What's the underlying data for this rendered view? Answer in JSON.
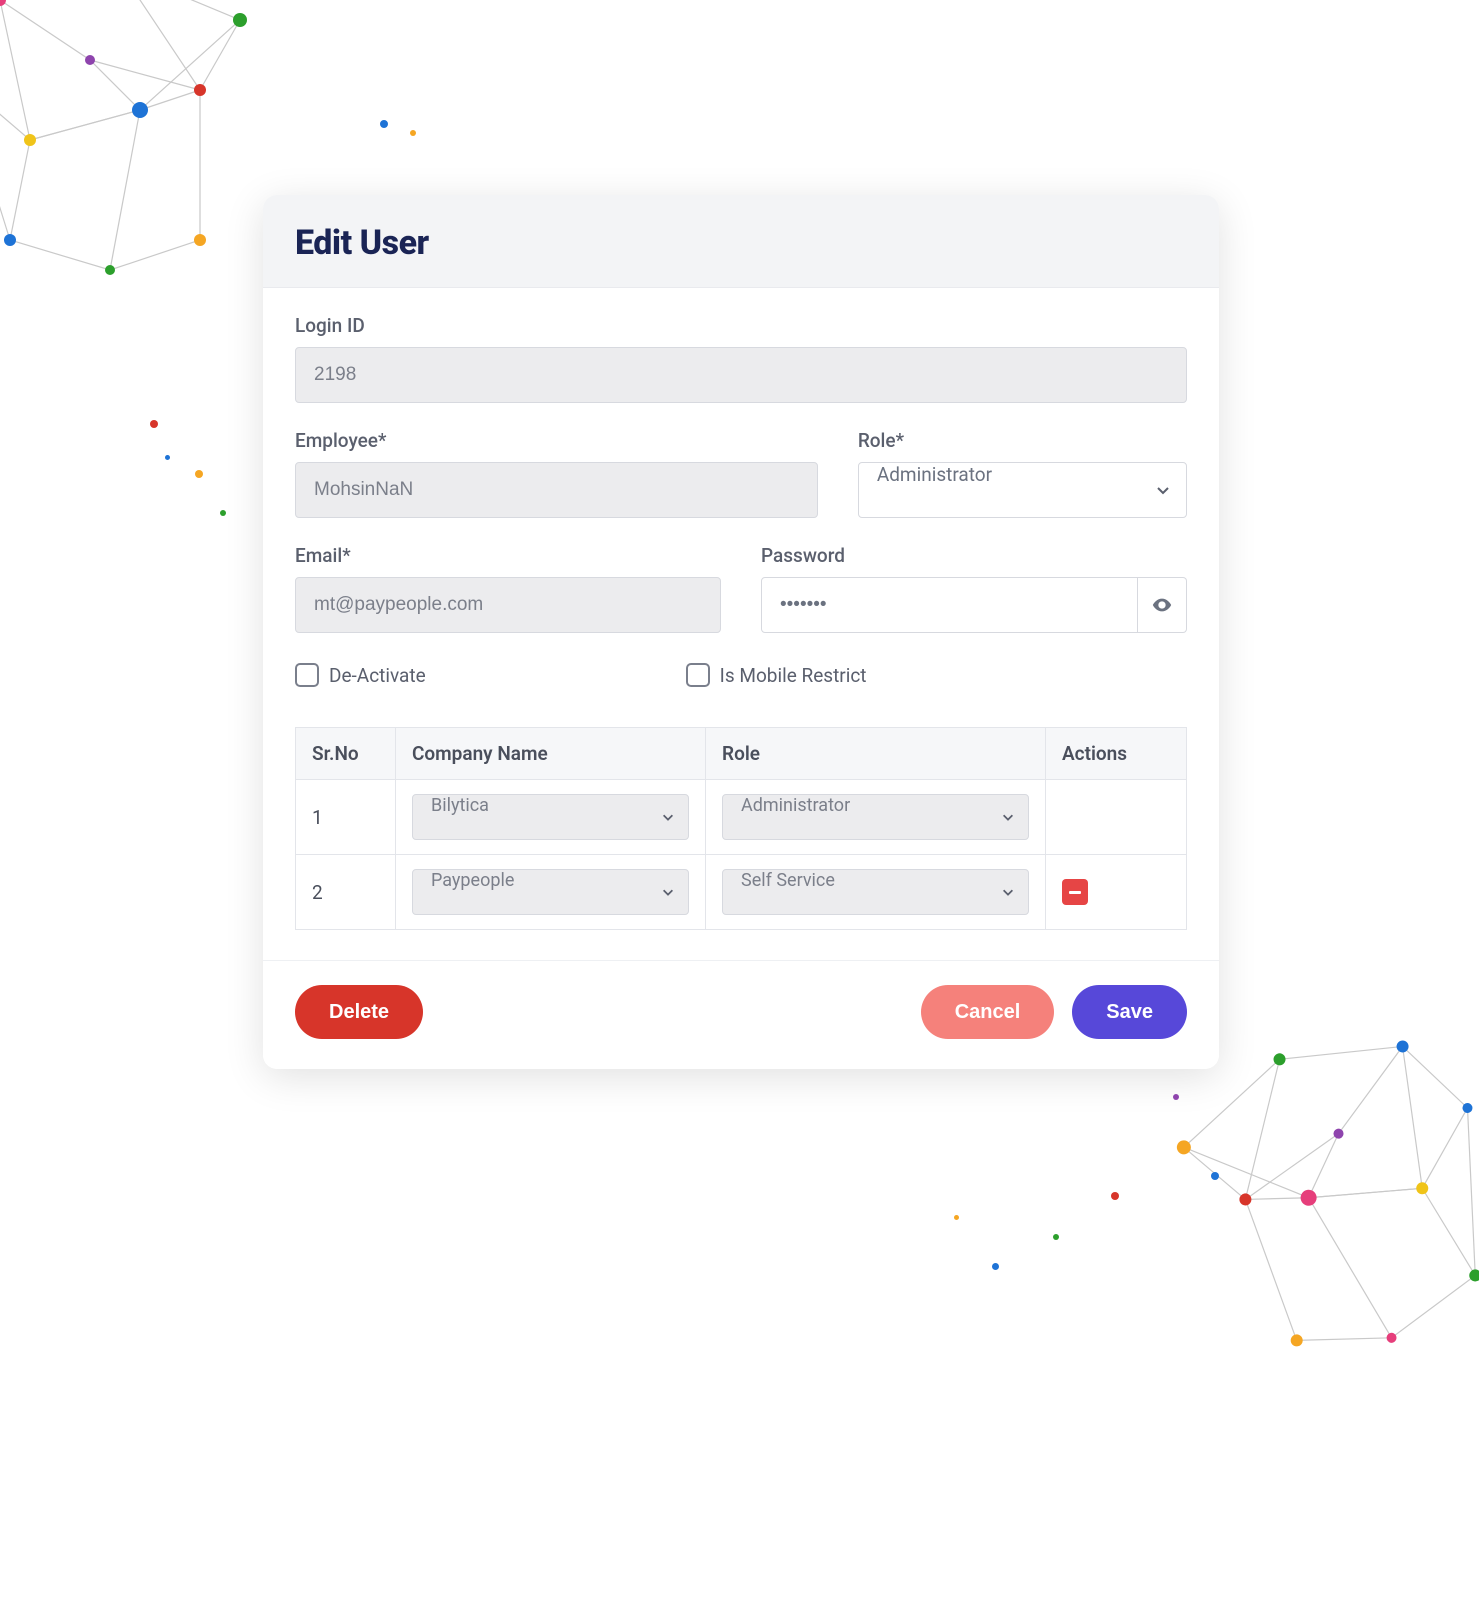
{
  "header": {
    "title": "Edit User"
  },
  "fields": {
    "login_id": {
      "label": "Login ID",
      "value": "2198"
    },
    "employee": {
      "label": "Employee*",
      "value": "MohsinNaN"
    },
    "role": {
      "label": "Role*",
      "value": "Administrator"
    },
    "email": {
      "label": "Email*",
      "value": "mt@paypeople.com"
    },
    "password": {
      "label": "Password",
      "value": "•••••••"
    }
  },
  "checks": {
    "deactivate": {
      "label": "De-Activate",
      "checked": false
    },
    "mobile_restrict": {
      "label": "Is Mobile Restrict",
      "checked": false
    }
  },
  "table": {
    "headers": {
      "srno": "Sr.No",
      "company": "Company Name",
      "role": "Role",
      "actions": "Actions"
    },
    "rows": [
      {
        "srno": "1",
        "company": "Bilytica",
        "role": "Administrator",
        "removable": false
      },
      {
        "srno": "2",
        "company": "Paypeople",
        "role": "Self Service",
        "removable": true
      }
    ]
  },
  "buttons": {
    "delete": "Delete",
    "cancel": "Cancel",
    "save": "Save"
  },
  "colors": {
    "title": "#1a2455",
    "delete": "#d7352a",
    "cancel": "#f5817b",
    "save": "#5748d9",
    "remove_icon": "#e64545"
  }
}
